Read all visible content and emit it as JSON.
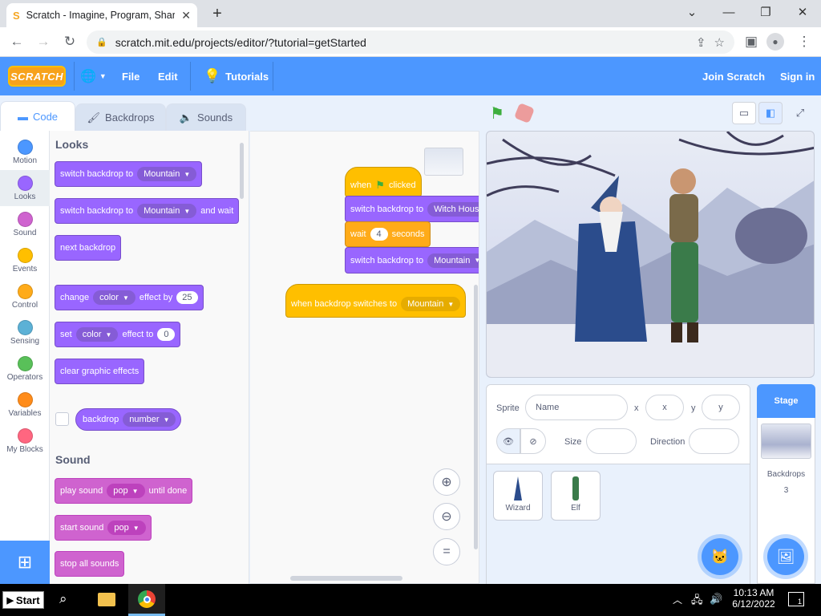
{
  "browser": {
    "tab_title": "Scratch - Imagine, Program, Shar",
    "url": "scratch.mit.edu/projects/editor/?tutorial=getStarted"
  },
  "menubar": {
    "logo": "SCRATCH",
    "file": "File",
    "edit": "Edit",
    "tutorials": "Tutorials",
    "join": "Join Scratch",
    "signin": "Sign in"
  },
  "tabs": {
    "code": "Code",
    "backdrops": "Backdrops",
    "sounds": "Sounds"
  },
  "categories": [
    {
      "label": "Motion",
      "color": "#4c97ff"
    },
    {
      "label": "Looks",
      "color": "#9966ff"
    },
    {
      "label": "Sound",
      "color": "#cf63cf"
    },
    {
      "label": "Events",
      "color": "#ffbf00"
    },
    {
      "label": "Control",
      "color": "#ffab19"
    },
    {
      "label": "Sensing",
      "color": "#5cb1d6"
    },
    {
      "label": "Operators",
      "color": "#59c059"
    },
    {
      "label": "Variables",
      "color": "#ff8c1a"
    },
    {
      "label": "My Blocks",
      "color": "#ff6680"
    }
  ],
  "palette": {
    "looks_title": "Looks",
    "switch_backdrop": "switch backdrop to",
    "mountain": "Mountain",
    "and_wait": "and wait",
    "next_backdrop": "next backdrop",
    "change": "change",
    "color": "color",
    "effect_by": "effect by",
    "effect_by_value": "25",
    "set": "set",
    "effect_to": "effect to",
    "effect_to_value": "0",
    "clear_effects": "clear graphic effects",
    "backdrop": "backdrop",
    "number": "number",
    "sound_title": "Sound",
    "play_sound": "play sound",
    "pop": "pop",
    "until_done": "until done",
    "start_sound": "start sound",
    "stop_all": "stop all sounds"
  },
  "script": {
    "when": "when",
    "clicked": "clicked",
    "switch_backdrop": "switch backdrop to",
    "witch_house": "Witch House",
    "wait": "wait",
    "wait_value": "4",
    "seconds": "seconds",
    "mountain": "Mountain",
    "when_backdrop_switches": "when backdrop switches to"
  },
  "sprite_info": {
    "sprite_label": "Sprite",
    "name_placeholder": "Name",
    "x_label": "x",
    "x_placeholder": "x",
    "y_label": "y",
    "y_placeholder": "y",
    "size_label": "Size",
    "direction_label": "Direction"
  },
  "sprites": [
    {
      "name": "Wizard"
    },
    {
      "name": "Elf"
    }
  ],
  "stage_pane": {
    "header": "Stage",
    "backdrops_label": "Backdrops",
    "backdrops_count": "3"
  },
  "taskbar": {
    "start": "Start",
    "time": "10:13 AM",
    "date": "6/12/2022",
    "notifications": "1"
  }
}
